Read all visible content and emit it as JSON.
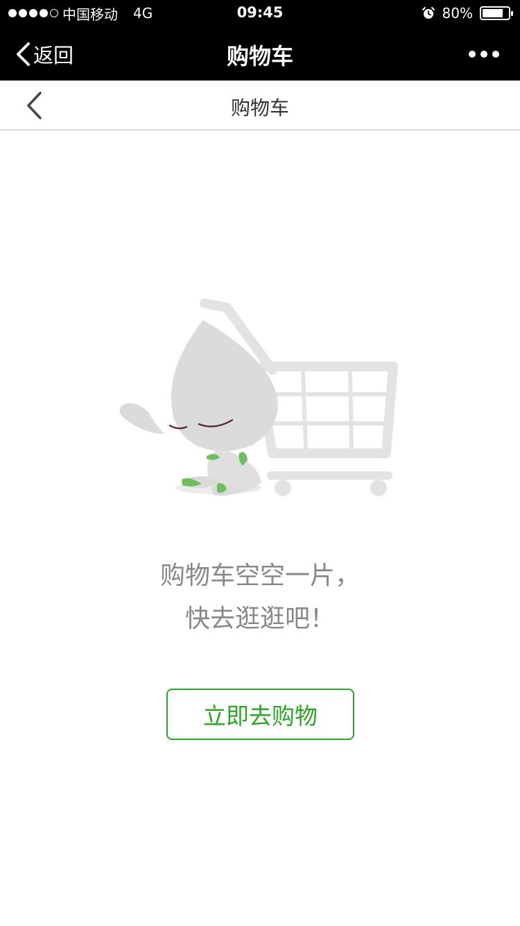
{
  "status_bar": {
    "carrier": "中国移动",
    "network": "4G",
    "time": "09:45",
    "battery": "80%",
    "battery_level": 0.8,
    "signal_bars": 4
  },
  "wechat_nav": {
    "back_label": "返回",
    "title": "购物车"
  },
  "page_header": {
    "title": "购物车"
  },
  "empty_state": {
    "line1": "购物车空空一片，",
    "line2": "快去逛逛吧！",
    "button_label": "立即去购物"
  },
  "colors": {
    "accent": "#29a823",
    "text_muted": "#888888",
    "nav_bg": "#000000"
  }
}
